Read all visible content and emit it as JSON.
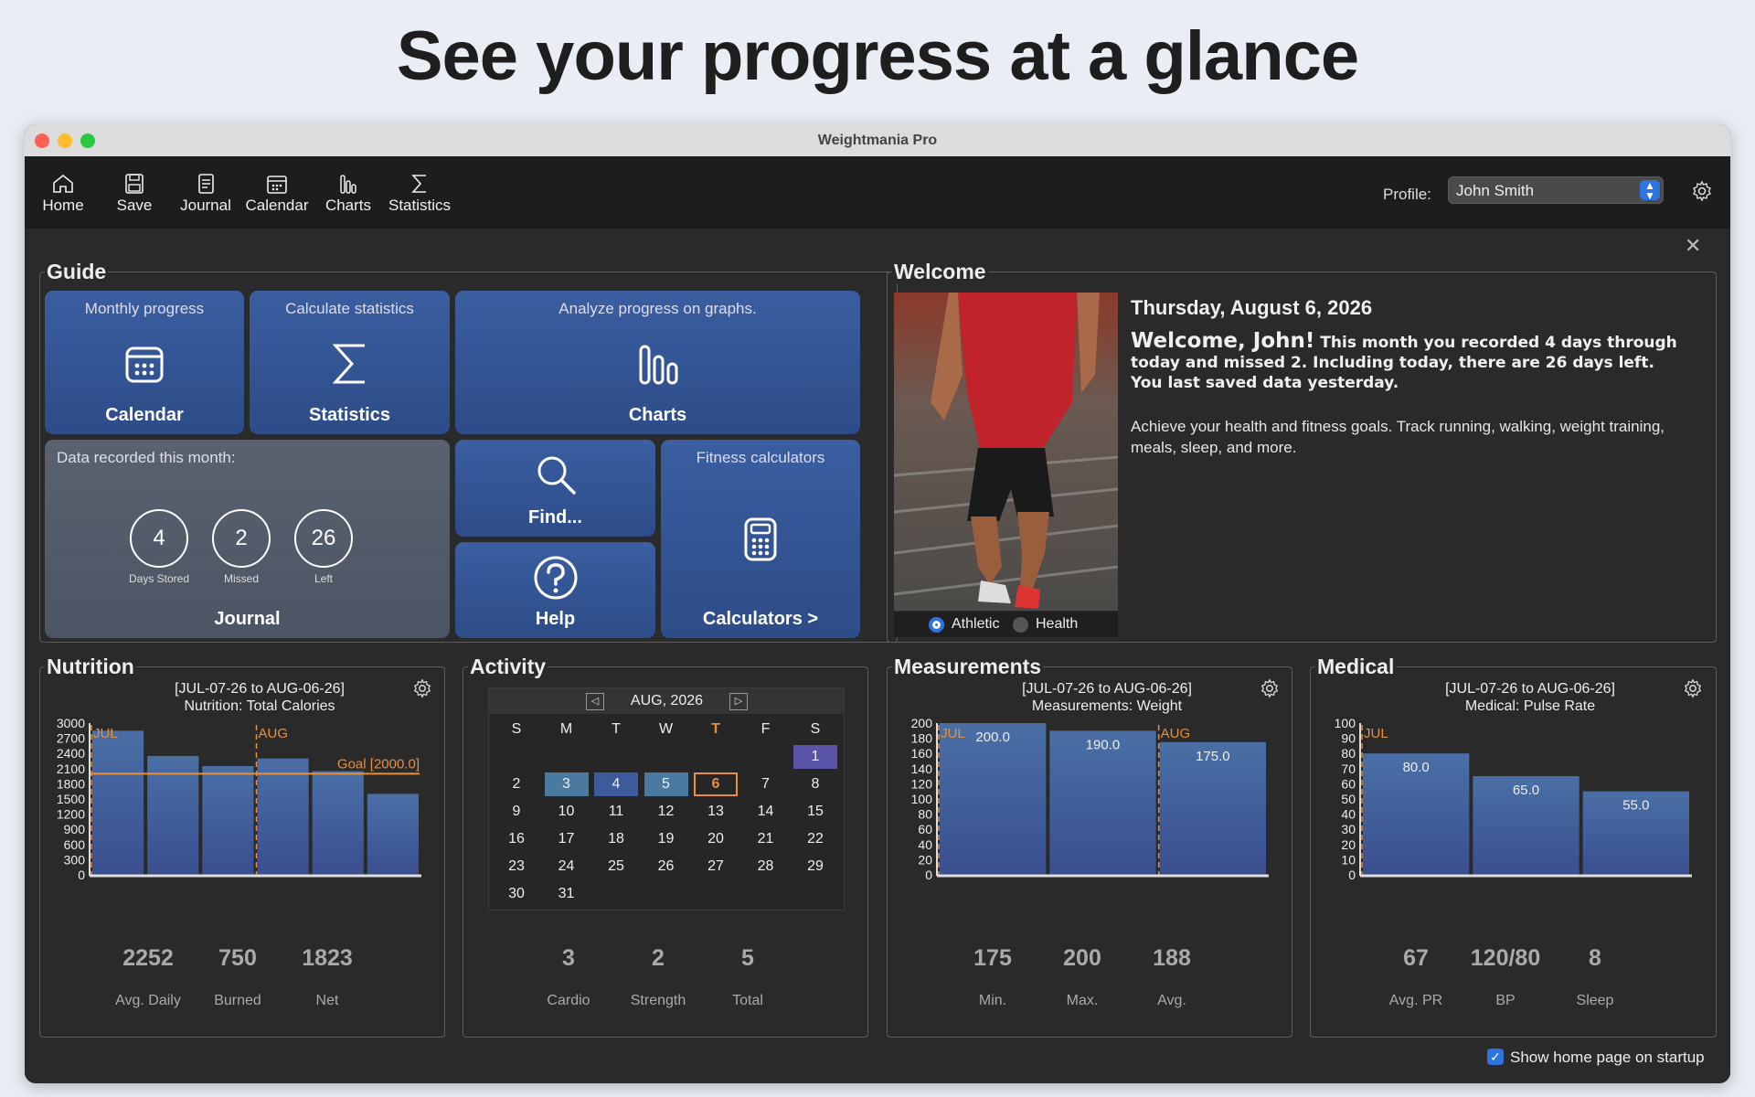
{
  "headline": "See your progress at a glance",
  "window_title": "Weightmania Pro",
  "toolbar": {
    "items": [
      {
        "label": "Home",
        "icon": "home-icon"
      },
      {
        "label": "Save",
        "icon": "save-icon"
      },
      {
        "label": "Journal",
        "icon": "journal-icon"
      },
      {
        "label": "Calendar",
        "icon": "calendar-icon"
      },
      {
        "label": "Charts",
        "icon": "charts-icon"
      },
      {
        "label": "Statistics",
        "icon": "sigma-icon"
      }
    ],
    "profile_label": "Profile:",
    "profile_value": "John Smith"
  },
  "guide": {
    "title": "Guide",
    "calendar": {
      "top": "Monthly progress",
      "bottom": "Calendar"
    },
    "statistics": {
      "top": "Calculate statistics",
      "bottom": "Statistics"
    },
    "charts": {
      "top": "Analyze progress on graphs.",
      "bottom": "Charts"
    },
    "journal": {
      "top": "Data recorded this month:",
      "bottom": "Journal",
      "circles": [
        {
          "value": "4",
          "label": "Days Stored"
        },
        {
          "value": "2",
          "label": "Missed"
        },
        {
          "value": "26",
          "label": "Left"
        }
      ]
    },
    "find": "Find...",
    "help": "Help",
    "calculators": {
      "top": "Fitness calculators",
      "bottom": "Calculators >"
    }
  },
  "welcome": {
    "title": "Welcome",
    "date": "Thursday, August 6, 2026",
    "greeting": "Welcome, John!",
    "summary": "This month you recorded 4 days through today and missed 2. Including today, there are 26 days left. You last saved data yesterday.",
    "body": "Achieve your health and fitness goals. Track running, walking, weight training, meals, sleep, and more.",
    "radio": [
      {
        "label": "Athletic",
        "selected": true
      },
      {
        "label": "Health",
        "selected": false
      }
    ]
  },
  "nutrition": {
    "title": "Nutrition",
    "range": "[JUL-07-26 to AUG-06-26]",
    "subtitle": "Nutrition:  Total Calories",
    "stats": [
      {
        "value": "2252",
        "label": "Avg. Daily"
      },
      {
        "value": "750",
        "label": "Burned"
      },
      {
        "value": "1823",
        "label": "Net"
      }
    ]
  },
  "activity": {
    "title": "Activity",
    "month": "AUG, 2026",
    "weekdays": [
      "S",
      "M",
      "T",
      "W",
      "T",
      "F",
      "S"
    ],
    "today_col": 4,
    "weeks": [
      [
        "",
        "",
        "",
        "",
        "",
        "",
        "1"
      ],
      [
        "2",
        "3",
        "4",
        "5",
        "6",
        "7",
        "8"
      ],
      [
        "9",
        "10",
        "11",
        "12",
        "13",
        "14",
        "15"
      ],
      [
        "16",
        "17",
        "18",
        "19",
        "20",
        "21",
        "22"
      ],
      [
        "23",
        "24",
        "25",
        "26",
        "27",
        "28",
        "29"
      ],
      [
        "30",
        "31",
        "",
        "",
        "",
        "",
        ""
      ]
    ],
    "stats": [
      {
        "value": "3",
        "label": "Cardio"
      },
      {
        "value": "2",
        "label": "Strength"
      },
      {
        "value": "5",
        "label": "Total"
      }
    ]
  },
  "measurements": {
    "title": "Measurements",
    "range": "[JUL-07-26 to AUG-06-26]",
    "subtitle": "Measurements:  Weight",
    "stats": [
      {
        "value": "175",
        "label": "Min."
      },
      {
        "value": "200",
        "label": "Max."
      },
      {
        "value": "188",
        "label": "Avg."
      }
    ]
  },
  "medical": {
    "title": "Medical",
    "range": "[JUL-07-26 to AUG-06-26]",
    "subtitle": "Medical:  Pulse Rate",
    "stats": [
      {
        "value": "67",
        "label": "Avg. PR"
      },
      {
        "value": "120/80",
        "label": "BP"
      },
      {
        "value": "8",
        "label": "Sleep"
      }
    ]
  },
  "footer": {
    "show_startup": "Show home page on startup"
  },
  "chart_data": [
    {
      "type": "bar",
      "title": "Nutrition:  Total Calories",
      "values": [
        2850,
        2350,
        2150,
        2300,
        2050,
        1600
      ],
      "ylim": [
        0,
        3000
      ],
      "yticks": [
        0,
        300,
        600,
        900,
        1200,
        1500,
        1800,
        2100,
        2400,
        2700,
        3000
      ],
      "markers": [
        {
          "label": "JUL",
          "index": 0
        },
        {
          "label": "AUG",
          "index": 3
        }
      ],
      "goal": {
        "value": 2000,
        "label": "Goal [2000.0]"
      }
    },
    {
      "type": "bar",
      "title": "Measurements:  Weight",
      "values": [
        200,
        190,
        175
      ],
      "labels": [
        "200.0",
        "190.0",
        "175.0"
      ],
      "ylim": [
        0,
        200
      ],
      "yticks": [
        0,
        20,
        40,
        60,
        80,
        100,
        120,
        140,
        160,
        180,
        200
      ],
      "markers": [
        {
          "label": "JUL",
          "index": 0
        },
        {
          "label": "AUG",
          "index": 2
        }
      ]
    },
    {
      "type": "bar",
      "title": "Medical:  Pulse Rate",
      "values": [
        80,
        65,
        55
      ],
      "labels": [
        "80.0",
        "65.0",
        "55.0"
      ],
      "ylim": [
        0,
        100
      ],
      "yticks": [
        0,
        10,
        20,
        30,
        40,
        50,
        60,
        70,
        80,
        90,
        100
      ],
      "markers": [
        {
          "label": "JUL",
          "index": 0
        }
      ]
    }
  ],
  "colors": {
    "tile": "#3a5ea0",
    "accent": "#e8903a",
    "selection": "#2f73e0",
    "calendar_purple": "#5a55a8",
    "calendar_teal": "#4a7aa0"
  }
}
